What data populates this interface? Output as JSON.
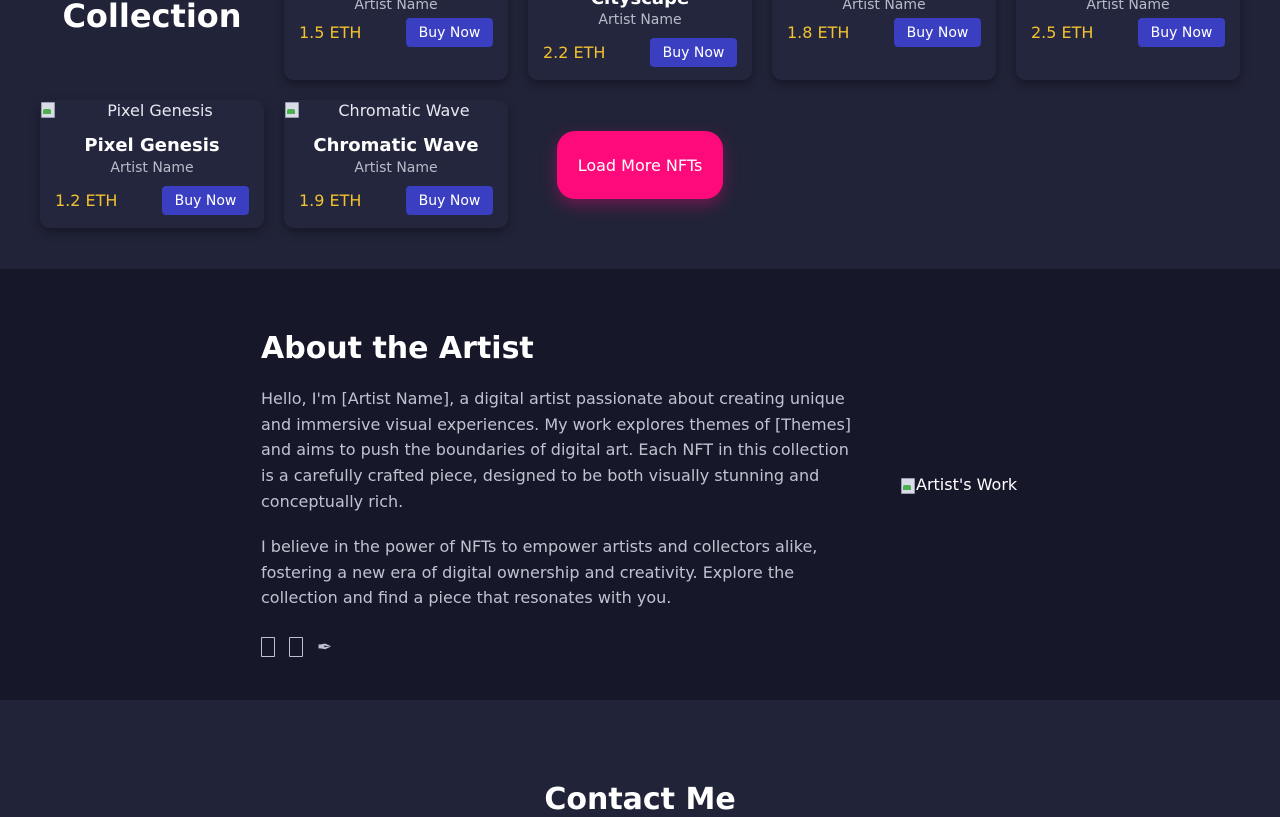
{
  "collection": {
    "title": "Collection",
    "buy_label": "Buy Now",
    "load_more_label": "Load More NFTs",
    "cards": [
      {
        "title": "",
        "artist": "Artist Name",
        "price": "1.5 ETH"
      },
      {
        "title": "Cityscape",
        "artist": "Artist Name",
        "price": "2.2 ETH"
      },
      {
        "title": "",
        "artist": "Artist Name",
        "price": "1.8 ETH"
      },
      {
        "title": "",
        "artist": "Artist Name",
        "price": "2.5 ETH"
      },
      {
        "title": "Pixel Genesis",
        "image_alt": "Pixel Genesis",
        "artist": "Artist Name",
        "price": "1.2 ETH"
      },
      {
        "title": "Chromatic Wave",
        "image_alt": "Chromatic Wave",
        "artist": "Artist Name",
        "price": "1.9 ETH"
      }
    ]
  },
  "about": {
    "title": "About the Artist",
    "paragraph1": "Hello, I'm [Artist Name], a digital artist passionate about creating unique and immersive visual experiences. My work explores themes of [Themes] and aims to push the boundaries of digital art. Each NFT in this collection is a carefully crafted piece, designed to be both visually stunning and conceptually rich.",
    "paragraph2": "I believe in the power of NFTs to empower artists and collectors alike, fostering a new era of digital ownership and creativity. Explore the collection and find a piece that resonates with you.",
    "image_alt": "Artist's Work",
    "social_pen_glyph": "✒"
  },
  "contact": {
    "title": "Contact Me"
  },
  "colors": {
    "background": "#212339",
    "about_background": "#161729",
    "price": "#f2c12e",
    "buy_button": "#3a3ec0",
    "load_more": "#ff0a7a"
  }
}
